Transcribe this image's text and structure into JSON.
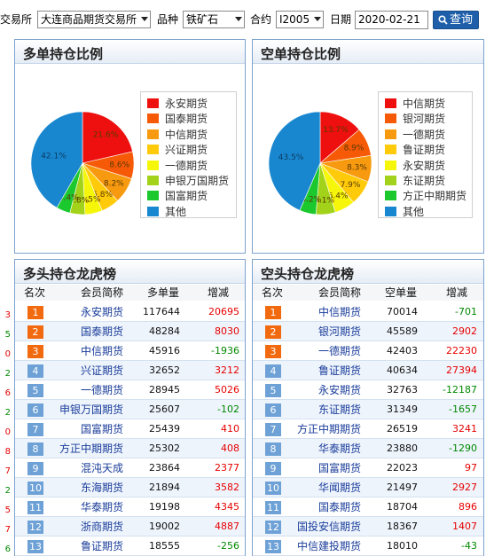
{
  "filter": {
    "exchange_label": "交易所",
    "exchange_value": "大连商品期货交易所",
    "variety_label": "品种",
    "variety_value": "铁矿石",
    "contract_label": "合约",
    "contract_value": "I2005",
    "date_label": "日期",
    "date_value": "2020-02-21",
    "query_label": "查询"
  },
  "long_pie": {
    "title": "多单持仓比例",
    "legend": [
      "永安期货",
      "国泰期货",
      "中信期货",
      "兴证期货",
      "一德期货",
      "申银万国期货",
      "国富期货",
      "其他"
    ],
    "colors": [
      "#ee0f0f",
      "#f75a06",
      "#f79a10",
      "#ffca0a",
      "#f6f60a",
      "#a2d21a",
      "#1bc82e",
      "#1987cf"
    ],
    "values": [
      21.6,
      8.6,
      8.2,
      5.8,
      5.5,
      4.8,
      4.4,
      42.1
    ],
    "labels": [
      "21.6%",
      "8.6%",
      "8.2%",
      "5.8%",
      "5.5%",
      "4.8%",
      "4.4%",
      "42.1%"
    ]
  },
  "short_pie": {
    "title": "空单持仓比例",
    "legend": [
      "中信期货",
      "银河期货",
      "一德期货",
      "鲁证期货",
      "永安期货",
      "东证期货",
      "方正中期期货",
      "其他"
    ],
    "colors": [
      "#ee0f0f",
      "#f75a06",
      "#f79a10",
      "#ffca0a",
      "#f6f60a",
      "#a2d21a",
      "#1bc82e",
      "#1987cf"
    ],
    "values": [
      13.7,
      8.9,
      8.3,
      7.9,
      6.4,
      6.1,
      5.2,
      43.5
    ],
    "labels": [
      "13.7%",
      "8.9%",
      "8.3%",
      "7.9%",
      "6.4%",
      "6.1%",
      "5.2%",
      "43.5%"
    ]
  },
  "long_table": {
    "title": "多头持仓龙虎榜",
    "headers": [
      "名次",
      "会员简称",
      "多单量",
      "增减"
    ],
    "rows": [
      {
        "rank": "1",
        "name": "永安期货",
        "vol": "117644",
        "chg": "20695"
      },
      {
        "rank": "2",
        "name": "国泰期货",
        "vol": "48284",
        "chg": "8030"
      },
      {
        "rank": "3",
        "name": "中信期货",
        "vol": "45916",
        "chg": "-1936"
      },
      {
        "rank": "4",
        "name": "兴证期货",
        "vol": "32652",
        "chg": "3212"
      },
      {
        "rank": "5",
        "name": "一德期货",
        "vol": "28945",
        "chg": "5026"
      },
      {
        "rank": "6",
        "name": "申银万国期货",
        "vol": "25607",
        "chg": "-102"
      },
      {
        "rank": "7",
        "name": "国富期货",
        "vol": "25439",
        "chg": "410"
      },
      {
        "rank": "8",
        "name": "方正中期期货",
        "vol": "25302",
        "chg": "408"
      },
      {
        "rank": "9",
        "name": "混沌天成",
        "vol": "23864",
        "chg": "2377"
      },
      {
        "rank": "10",
        "name": "东海期货",
        "vol": "21894",
        "chg": "3582"
      },
      {
        "rank": "11",
        "name": "华泰期货",
        "vol": "19198",
        "chg": "4345"
      },
      {
        "rank": "12",
        "name": "浙商期货",
        "vol": "19002",
        "chg": "4887"
      },
      {
        "rank": "13",
        "name": "鲁证期货",
        "vol": "18555",
        "chg": "-256"
      }
    ]
  },
  "short_table": {
    "title": "空头持仓龙虎榜",
    "headers": [
      "名次",
      "会员简称",
      "空单量",
      "增减"
    ],
    "rows": [
      {
        "rank": "1",
        "name": "中信期货",
        "vol": "70014",
        "chg": "-701"
      },
      {
        "rank": "2",
        "name": "银河期货",
        "vol": "45589",
        "chg": "2902"
      },
      {
        "rank": "3",
        "name": "一德期货",
        "vol": "42403",
        "chg": "22230"
      },
      {
        "rank": "4",
        "name": "鲁证期货",
        "vol": "40634",
        "chg": "27394"
      },
      {
        "rank": "5",
        "name": "永安期货",
        "vol": "32763",
        "chg": "-12187"
      },
      {
        "rank": "6",
        "name": "东证期货",
        "vol": "31349",
        "chg": "-1657"
      },
      {
        "rank": "7",
        "name": "方正中期期货",
        "vol": "26519",
        "chg": "3241"
      },
      {
        "rank": "8",
        "name": "华泰期货",
        "vol": "23880",
        "chg": "-1290"
      },
      {
        "rank": "9",
        "name": "国富期货",
        "vol": "22023",
        "chg": "97"
      },
      {
        "rank": "10",
        "name": "华闻期货",
        "vol": "21497",
        "chg": "2927"
      },
      {
        "rank": "11",
        "name": "国泰期货",
        "vol": "18704",
        "chg": "896"
      },
      {
        "rank": "12",
        "name": "国投安信期货",
        "vol": "18367",
        "chg": "1407"
      },
      {
        "rank": "13",
        "name": "中信建投期货",
        "vol": "18010",
        "chg": "-43"
      }
    ]
  },
  "left_edge_digits": [
    "3",
    "5",
    "0",
    "2",
    "6",
    "2",
    "0",
    "8",
    "7",
    "2",
    "5",
    "7",
    "6"
  ],
  "colors": {
    "panel_border": "#7da2ce",
    "rank_top": "#f26a10",
    "rank_normal": "#6ea1d6",
    "increase": "#e60000",
    "decrease": "#008800",
    "member_link": "#1a3d9a",
    "query_button": "#1f5faa"
  }
}
